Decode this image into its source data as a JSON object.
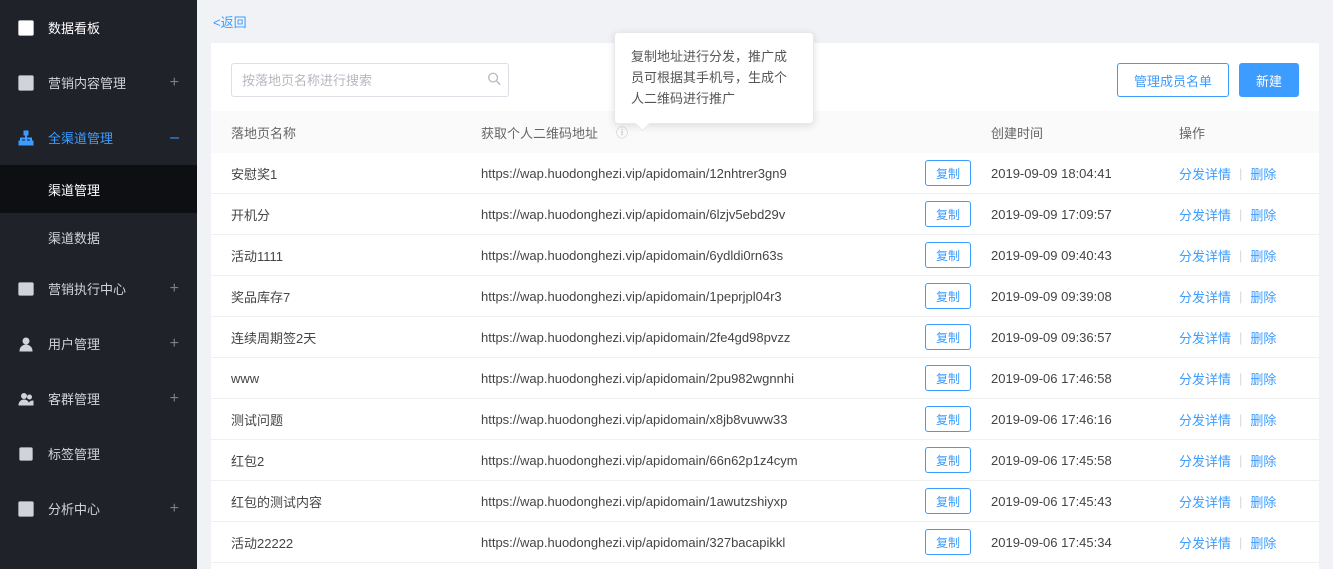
{
  "tooltip": "复制地址进行分发，推广成员可根据其手机号，生成个人二维码进行推广",
  "back": "<返回",
  "search": {
    "placeholder": "按落地页名称进行搜索"
  },
  "buttons": {
    "members": "管理成员名单",
    "create": "新建",
    "copy": "复制"
  },
  "sidebar": {
    "items": [
      {
        "label": "数据看板",
        "expand": ""
      },
      {
        "label": "营销内容管理",
        "expand": "+"
      },
      {
        "label": "全渠道管理",
        "expand": "–"
      },
      {
        "label": "营销执行中心",
        "expand": "+"
      },
      {
        "label": "用户管理",
        "expand": "+"
      },
      {
        "label": "客群管理",
        "expand": "+"
      },
      {
        "label": "标签管理",
        "expand": ""
      },
      {
        "label": "分析中心",
        "expand": "+"
      }
    ],
    "subs": [
      {
        "label": "渠道管理"
      },
      {
        "label": "渠道数据"
      }
    ]
  },
  "table": {
    "headers": {
      "name": "落地页名称",
      "url": "获取个人二维码地址",
      "time": "创建时间",
      "ops": "操作"
    },
    "ops": {
      "detail": "分发详情",
      "delete": "删除"
    },
    "rows": [
      {
        "name": "安慰奖1",
        "url": "https://wap.huodonghezi.vip/apidomain/12nhtrer3gn9",
        "time": "2019-09-09 18:04:41"
      },
      {
        "name": "开机分",
        "url": "https://wap.huodonghezi.vip/apidomain/6lzjv5ebd29v",
        "time": "2019-09-09 17:09:57"
      },
      {
        "name": "活动1111",
        "url": "https://wap.huodonghezi.vip/apidomain/6ydldi0rn63s",
        "time": "2019-09-09 09:40:43"
      },
      {
        "name": "奖品库存7",
        "url": "https://wap.huodonghezi.vip/apidomain/1peprjpl04r3",
        "time": "2019-09-09 09:39:08"
      },
      {
        "name": "连续周期签2天",
        "url": "https://wap.huodonghezi.vip/apidomain/2fe4gd98pvzz",
        "time": "2019-09-09 09:36:57"
      },
      {
        "name": "www",
        "url": "https://wap.huodonghezi.vip/apidomain/2pu982wgnnhi",
        "time": "2019-09-06 17:46:58"
      },
      {
        "name": "测试问题",
        "url": "https://wap.huodonghezi.vip/apidomain/x8jb8vuww33",
        "time": "2019-09-06 17:46:16"
      },
      {
        "name": "红包2",
        "url": "https://wap.huodonghezi.vip/apidomain/66n62p1z4cym",
        "time": "2019-09-06 17:45:58"
      },
      {
        "name": "红包的测试内容",
        "url": "https://wap.huodonghezi.vip/apidomain/1awutzshiyxp",
        "time": "2019-09-06 17:45:43"
      },
      {
        "name": "活动22222",
        "url": "https://wap.huodonghezi.vip/apidomain/327bacapikkl",
        "time": "2019-09-06 17:45:34"
      }
    ]
  }
}
